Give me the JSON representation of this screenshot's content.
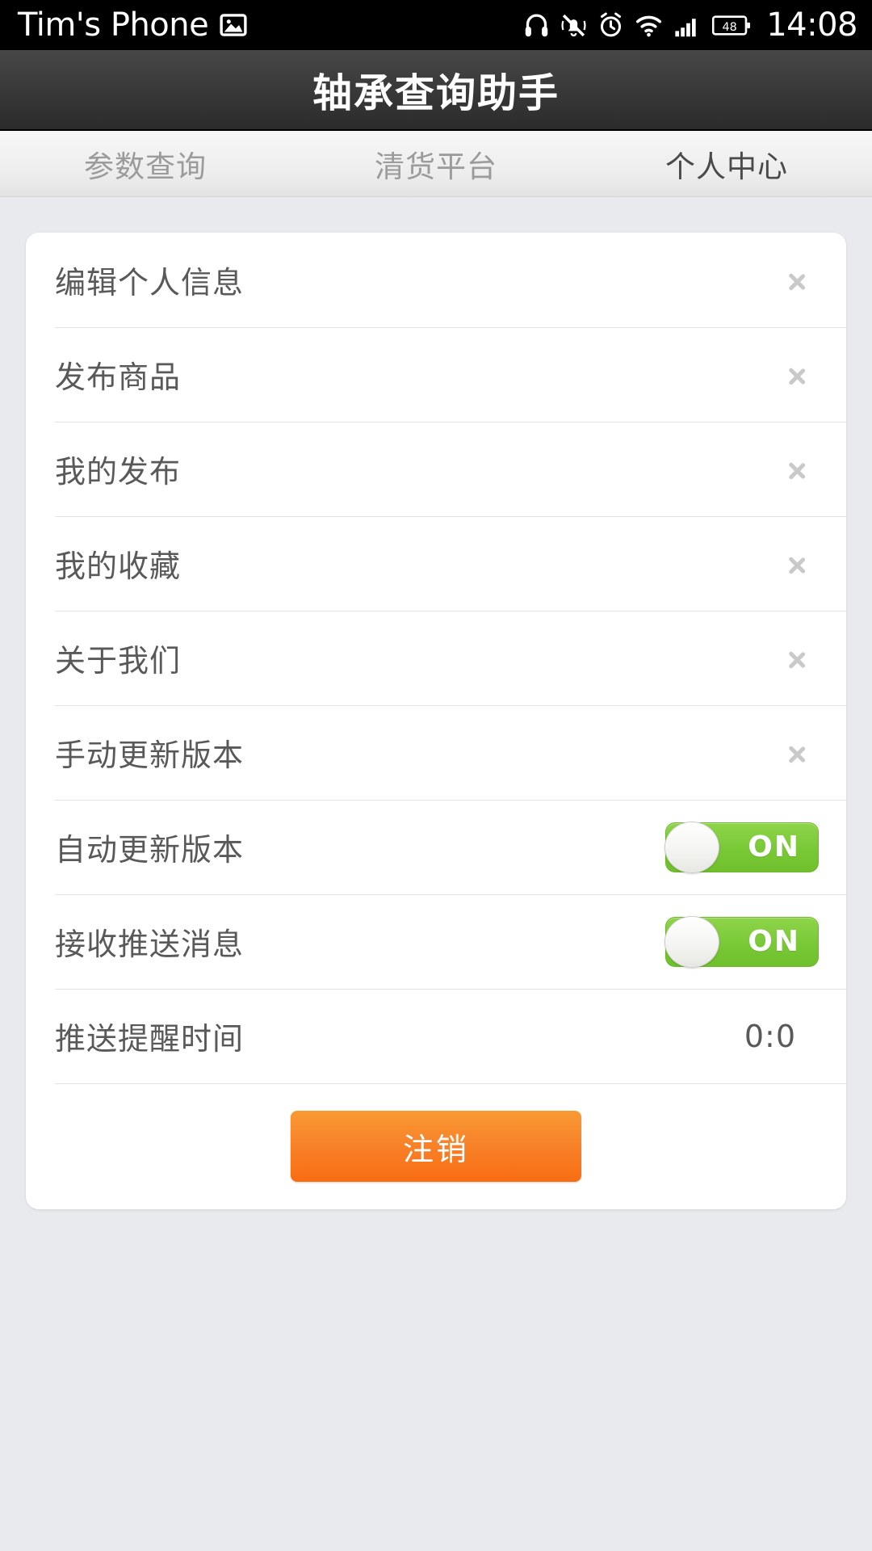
{
  "status_bar": {
    "device_name": "Tim's Phone",
    "time": "14:08",
    "battery_level": "48",
    "icons": [
      "image-icon",
      "headphones-icon",
      "vibrate-off-icon",
      "alarm-clock-icon",
      "wifi-icon",
      "signal-bars-icon",
      "battery-icon"
    ]
  },
  "header": {
    "title": "轴承查询助手"
  },
  "tabs": [
    {
      "label": "参数查询",
      "active": false
    },
    {
      "label": "清货平台",
      "active": false
    },
    {
      "label": "个人中心",
      "active": true
    }
  ],
  "menu": {
    "items": [
      {
        "label": "编辑个人信息",
        "type": "link"
      },
      {
        "label": "发布商品",
        "type": "link"
      },
      {
        "label": "我的发布",
        "type": "link"
      },
      {
        "label": "我的收藏",
        "type": "link"
      },
      {
        "label": "关于我们",
        "type": "link"
      },
      {
        "label": "手动更新版本",
        "type": "link"
      },
      {
        "label": "自动更新版本",
        "type": "toggle",
        "state": "ON"
      },
      {
        "label": "接收推送消息",
        "type": "toggle",
        "state": "ON"
      },
      {
        "label": "推送提醒时间",
        "type": "value",
        "value": "0:0"
      }
    ]
  },
  "actions": {
    "logout_label": "注销"
  },
  "colors": {
    "accent_orange": "#f8832a",
    "toggle_green": "#79c936",
    "page_background": "#e8eaee",
    "titlebar": "#3c3c3c",
    "card": "#ffffff",
    "text_primary": "#595959",
    "text_muted": "#9b9b9b"
  }
}
